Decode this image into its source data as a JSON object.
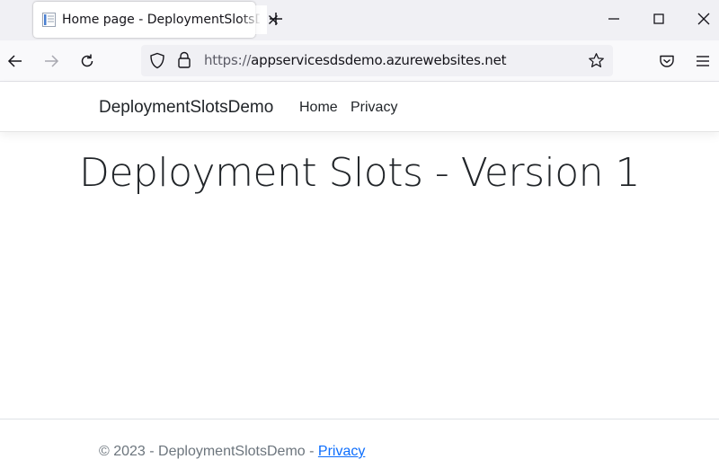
{
  "browser": {
    "tab": {
      "title": "Home page - DeploymentSlotsDemo"
    },
    "address_bar": {
      "scheme": "https://",
      "host": "appservicesdsdemo.azurewebsites.net"
    }
  },
  "site": {
    "brand": "DeploymentSlotsDemo",
    "nav": [
      "Home",
      "Privacy"
    ],
    "heading": "Deployment Slots - Version 1",
    "footer": {
      "text": "© 2023 - DeploymentSlotsDemo - ",
      "link": "Privacy"
    }
  },
  "colors": {
    "link": "#0d6efd",
    "footer_text": "#6c757d",
    "toolbar_bg": "#f9f9fb",
    "tabstrip_bg": "#f0f0f4"
  }
}
